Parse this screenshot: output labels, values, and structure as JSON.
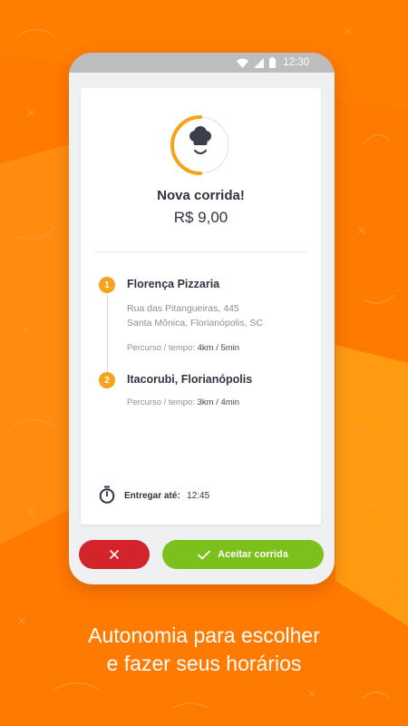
{
  "statusbar": {
    "time": "12:30"
  },
  "order": {
    "title": "Nova corrida!",
    "price": "R$ 9,00"
  },
  "stops": [
    {
      "number": "1",
      "name": "Florença Pizzaria",
      "address_line1": "Rua das Pitangueiras, 445",
      "address_line2": "Santa Mônica, Florianópolis, SC",
      "route_label": "Percurso / tempo:",
      "route_value": "4km / 5min"
    },
    {
      "number": "2",
      "name": "Itacorubi, Florianópolis",
      "route_label": "Percurso / tempo:",
      "route_value": "3km / 4min"
    }
  ],
  "deliver": {
    "label": "Entregar até:",
    "value": "12:45"
  },
  "actions": {
    "accept_label": "Aceitar corrida",
    "reject_icon": "close-icon"
  },
  "caption": {
    "line1": "Autonomia para escolher",
    "line2": "e fazer seus horários"
  },
  "colors": {
    "background": "#ff7a00",
    "accent": "#f7a21b",
    "accept": "#7cc01b",
    "reject": "#d3242b"
  }
}
